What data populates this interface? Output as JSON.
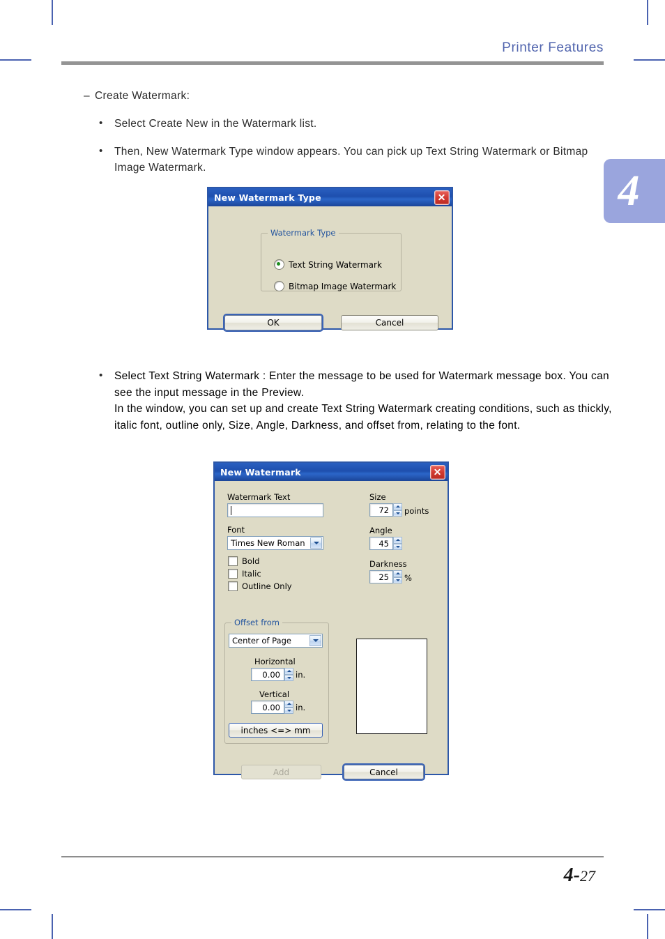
{
  "page": {
    "header_title": "Printer Features",
    "chapter_tab": "4",
    "footer_chapter": "4-",
    "footer_page": "27"
  },
  "content": {
    "dash_item": "Create Watermark:",
    "bullets": [
      "Select Create New in the Watermark list.",
      "Then, New Watermark Type window appears. You can pick up Text String Watermark or Bitmap Image Watermark.",
      "Select Text String Watermark : Enter the message to be used for Watermark message box. You can see the input message in the Preview.\nIn the window, you can set up and create Text String Watermark creating conditions, such as thickly, italic font, outline only, Size, Angle, Darkness, and offset from, relating to the font."
    ]
  },
  "dialog1": {
    "title": "New Watermark Type",
    "close_label": "close-icon",
    "group_label": "Watermark Type",
    "radio_text_string": "Text String Watermark",
    "radio_bitmap_image": "Bitmap Image Watermark",
    "selected": "Text String Watermark",
    "ok_label": "OK",
    "cancel_label": "Cancel"
  },
  "dialog2": {
    "title": "New Watermark",
    "close_label": "close-icon",
    "watermark_text_label": "Watermark Text",
    "watermark_text_value": "",
    "font_label": "Font",
    "font_value": "Times New Roman",
    "bold_label": "Bold",
    "italic_label": "Italic",
    "outline_only_label": "Outline Only",
    "bold_checked": false,
    "italic_checked": false,
    "outline_only_checked": false,
    "size_label": "Size",
    "size_value": "72",
    "size_unit": "points",
    "angle_label": "Angle",
    "angle_value": "45",
    "darkness_label": "Darkness",
    "darkness_value": "25",
    "darkness_unit": "%",
    "offset_group_label": "Offset from",
    "offset_origin_value": "Center of Page",
    "horizontal_label": "Horizontal",
    "horizontal_value": "0.00",
    "horizontal_unit": "in.",
    "vertical_label": "Vertical",
    "vertical_value": "0.00",
    "vertical_unit": "in.",
    "units_toggle_label": "inches <=> mm",
    "add_label": "Add",
    "add_disabled": true,
    "cancel_label": "Cancel"
  },
  "colors": {
    "header_blue": "#4f63ad",
    "chapter_tab_purple": "#9aa5dd",
    "dialog_face": "#dedbc6",
    "titlebar_blue": "#1e4fae",
    "close_red": "#d23a31",
    "group_label_blue": "#24559e",
    "crop_mark_blue": "#4a62b0"
  }
}
